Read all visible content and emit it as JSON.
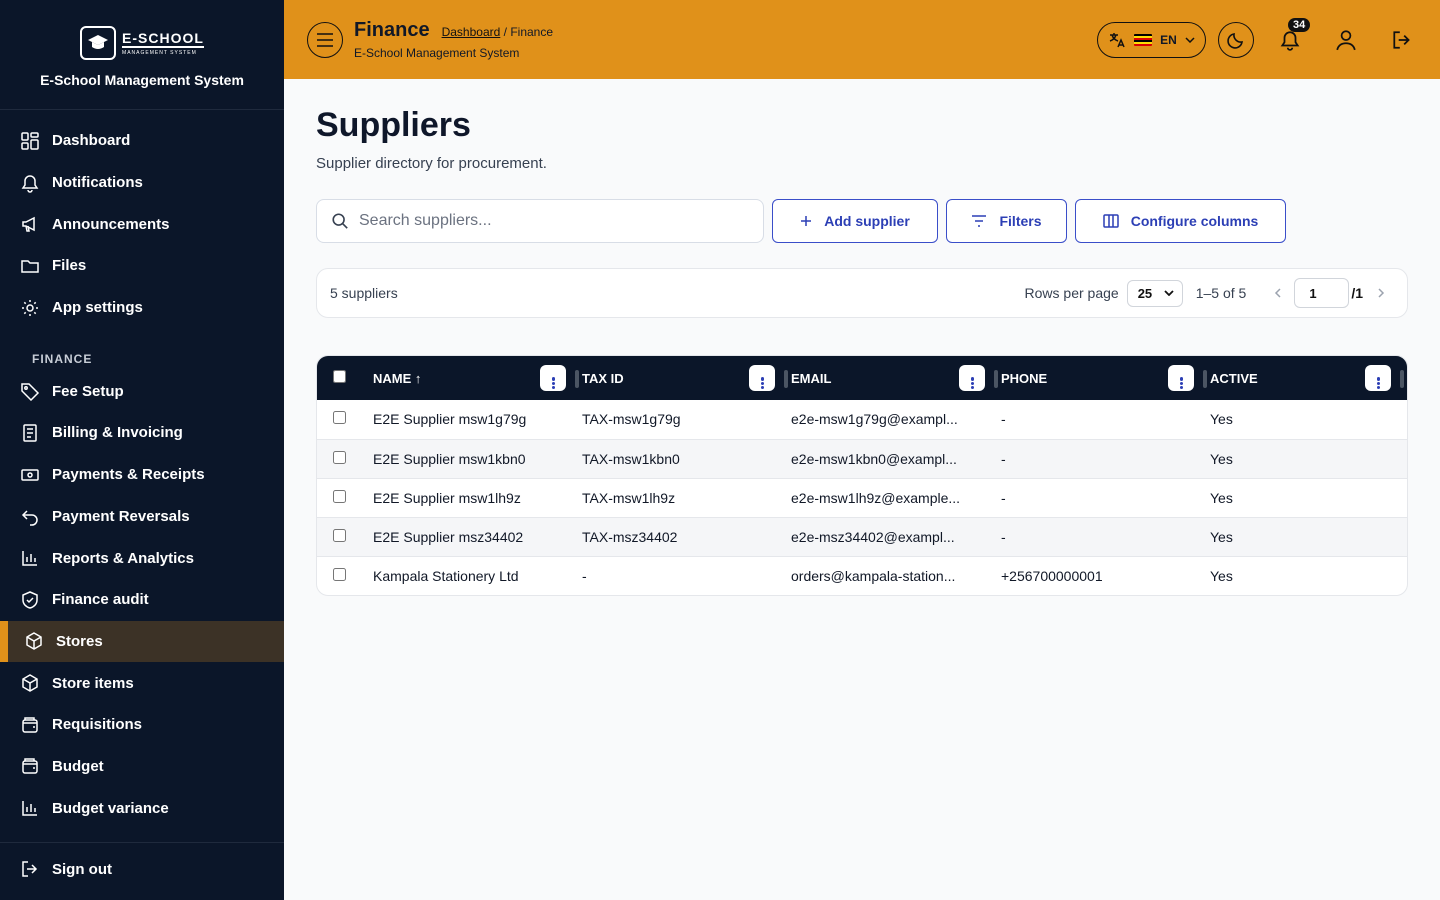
{
  "sidebar": {
    "logo_name": "E-SCHOOL",
    "logo_sub": "MANAGEMENT SYSTEM",
    "system_name": "E-School Management System",
    "items": [
      {
        "label": "Dashboard",
        "icon": "grid-icon"
      },
      {
        "label": "Notifications",
        "icon": "bell-icon"
      },
      {
        "label": "Announcements",
        "icon": "megaphone-icon"
      },
      {
        "label": "Files",
        "icon": "folder-icon"
      },
      {
        "label": "App settings",
        "icon": "gear-icon"
      }
    ],
    "section": "FINANCE",
    "finance_items": [
      {
        "label": "Fee Setup",
        "icon": "tag-icon"
      },
      {
        "label": "Billing & Invoicing",
        "icon": "invoice-icon"
      },
      {
        "label": "Payments & Receipts",
        "icon": "cash-icon"
      },
      {
        "label": "Payment Reversals",
        "icon": "undo-icon"
      },
      {
        "label": "Reports & Analytics",
        "icon": "bar-chart-icon"
      },
      {
        "label": "Finance audit",
        "icon": "shield-check-icon"
      },
      {
        "label": "Stores",
        "icon": "box-icon",
        "active": true
      },
      {
        "label": "Store items",
        "icon": "box-icon"
      },
      {
        "label": "Requisitions",
        "icon": "wallet-icon"
      },
      {
        "label": "Budget",
        "icon": "wallet-icon"
      },
      {
        "label": "Budget variance",
        "icon": "bar-chart-icon"
      }
    ],
    "sign_out": "Sign out"
  },
  "topbar": {
    "title": "Finance",
    "breadcrumb_link": "Dashboard",
    "breadcrumb_sep": "/",
    "breadcrumb_current": "Finance",
    "subtitle": "E-School Management System",
    "language": "EN",
    "notification_count": "34",
    "accent": "#e0911a"
  },
  "page": {
    "title": "Suppliers",
    "subtitle": "Supplier directory for procurement.",
    "search_placeholder": "Search suppliers...",
    "add_label": "Add supplier",
    "filters_label": "Filters",
    "configure_label": "Configure columns"
  },
  "pager": {
    "count": "5 suppliers",
    "rows_per_page_label": "Rows per page",
    "rows_per_page": "25",
    "range": "1–5 of 5",
    "page": "1",
    "total_pages": "/1"
  },
  "table": {
    "headers": [
      "NAME ↑",
      "TAX ID",
      "EMAIL",
      "PHONE",
      "ACTIVE"
    ],
    "rows": [
      [
        "E2E Supplier msw1g79g",
        "TAX-msw1g79g",
        "e2e-msw1g79g@exampl...",
        "-",
        "Yes"
      ],
      [
        "E2E Supplier msw1kbn0",
        "TAX-msw1kbn0",
        "e2e-msw1kbn0@exampl...",
        "-",
        "Yes"
      ],
      [
        "E2E Supplier msw1lh9z",
        "TAX-msw1lh9z",
        "e2e-msw1lh9z@example...",
        "-",
        "Yes"
      ],
      [
        "E2E Supplier msz34402",
        "TAX-msz34402",
        "e2e-msz34402@exampl...",
        "-",
        "Yes"
      ],
      [
        "Kampala Stationery Ltd",
        "-",
        "orders@kampala-station...",
        "+256700000001",
        "Yes"
      ]
    ]
  }
}
